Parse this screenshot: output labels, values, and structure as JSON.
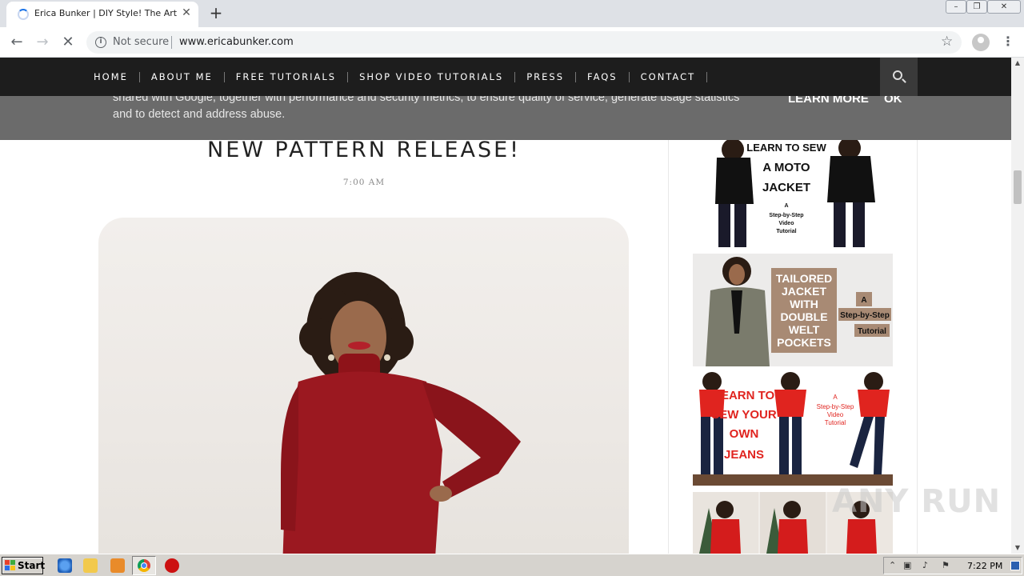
{
  "browser": {
    "tab_title": "Erica Bunker | DIY Style! The Art of Custom",
    "tab_close": "✕",
    "new_tab": "+",
    "not_secure": "Not secure",
    "url": "www.ericabunker.com",
    "window_controls": {
      "minimize": "–",
      "restore": "❐",
      "close": "✕"
    }
  },
  "site": {
    "nav": [
      "HOME",
      "ABOUT ME",
      "FREE TUTORIALS",
      "SHOP VIDEO TUTORIALS",
      "PRESS",
      "FAQS",
      "CONTACT"
    ],
    "cookie": {
      "text": "shared with Google, together with performance and security metrics, to ensure quality of service, generate usage statistics and to detect and address abuse.",
      "learn_more": "LEARN MORE",
      "ok": "OK"
    },
    "post": {
      "title": "NEW PATTERN RELEASE!",
      "time": "7:00 AM"
    },
    "sidebar_ads": [
      {
        "name": "moto-jacket",
        "lines": [
          "LEARN TO SEW",
          "A MOTO",
          "JACKET"
        ],
        "sub": [
          "A",
          "Step-by-Step",
          "Video",
          "Tutorial"
        ]
      },
      {
        "name": "tailored-jacket",
        "lines": [
          "TAILORED",
          "JACKET",
          "WITH",
          "DOUBLE",
          "WELT",
          "POCKETS"
        ],
        "sub": [
          "A",
          "Step-by-Step",
          "Tutorial"
        ]
      },
      {
        "name": "jeans",
        "lines": [
          "LEARN TO",
          "SEW YOUR",
          "OWN",
          "JEANS"
        ],
        "sub": [
          "A",
          "Step-by-Step",
          "Video",
          "Tutorial"
        ]
      }
    ],
    "watermark": "ANY RUN"
  },
  "taskbar": {
    "start": "Start",
    "clock": "7:22 PM"
  }
}
